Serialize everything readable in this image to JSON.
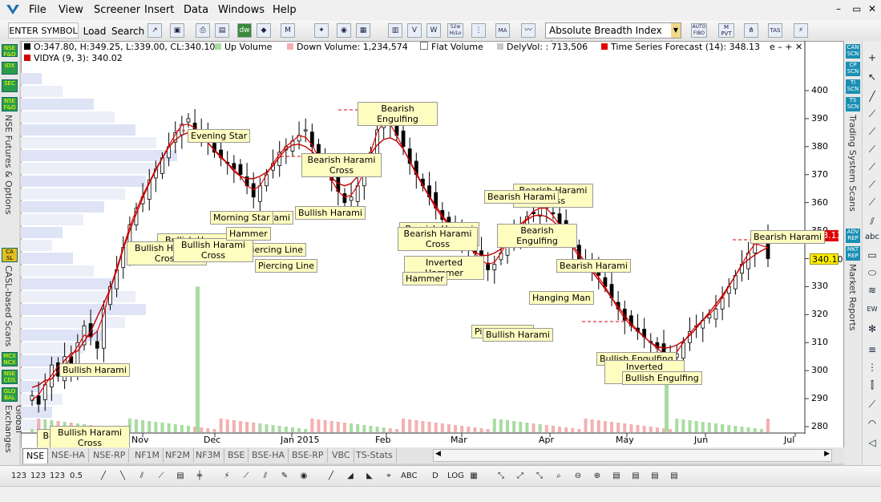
{
  "menu": {
    "items": [
      "File",
      "View",
      "Screener",
      "Insert",
      "Data",
      "Windows",
      "Help"
    ],
    "window_controls": [
      "–",
      "▭",
      "✕"
    ]
  },
  "toolbar": {
    "symbol_button": "ENTER SYMBOL",
    "load": "Load",
    "search": "Search",
    "indicator_value": "Absolute Breadth Index (ABI",
    "icon_labels": [
      "52w Hi/Lo",
      "MA",
      "AUTO FIBO",
      "M PVT",
      "TAS"
    ]
  },
  "legend": {
    "ohlc": "O:347.80, H:349.25, L:339.00, CL:340.10",
    "up_volume": "Up Volume",
    "down_volume": "Down Volume: 1,234,574",
    "flat_volume": "Flat Volume",
    "dely_vol": "DelyVol: : 713,506",
    "tsf": "Time Series Forecast (14): 348.13",
    "vidya": "VIDYA (9, 3): 340.02",
    "controls": "e – + ✕"
  },
  "colors": {
    "up_volume": "#a8dca0",
    "down_volume": "#f4b0b0",
    "flat_volume": "#ffffff",
    "dely_vol": "#c8c8c8",
    "tsf": "#e00000",
    "vidya": "#d00000",
    "price_tag_bg": "#e00000",
    "price_tag2_bg": "#ffee00"
  },
  "left_tabs": {
    "buttons": [
      "NSE F&O",
      "IDX",
      "SEC",
      "NSE F&O",
      "CA SL",
      "MCX NCX",
      "NSE CDS",
      "GLO BAL"
    ],
    "labels": [
      "NSE Futures & Options",
      "CASL-based Scans",
      "Global Exchanges"
    ]
  },
  "right_tabs": {
    "buttons": [
      "CAN SCN",
      "CP SCN",
      "TI SCN",
      "TS SCN",
      "ADV REP",
      "MKT REP"
    ],
    "labels": [
      "Trading System Scans",
      "Market Reports"
    ]
  },
  "price_tags": {
    "tsf": "348.13",
    "vidya": "340.10"
  },
  "exchange_tabs": [
    "NSE",
    "NSE-HA",
    "NSE-RP",
    "NF1M",
    "NF2M",
    "NF3M",
    "BSE",
    "BSE-HA",
    "BSE-RP",
    "VBC",
    "TS-Stats"
  ],
  "chart_data": {
    "type": "candlestick",
    "y_ticks": [
      400,
      390,
      380,
      370,
      360,
      350,
      340,
      330,
      320,
      310,
      300,
      290,
      280
    ],
    "ylim": [
      278,
      408
    ],
    "x_ticks": [
      "Oct 2014",
      "Nov",
      "Dec",
      "Jan 2015",
      "Feb",
      "Mar",
      "Apr",
      "May",
      "Jun",
      "Jul"
    ],
    "close_series": [
      291,
      288,
      295,
      302,
      298,
      305,
      300,
      310,
      316,
      312,
      308,
      322,
      330,
      336,
      344,
      352,
      358,
      362,
      368,
      372,
      376,
      380,
      385,
      388,
      390,
      386,
      384,
      382,
      378,
      376,
      374,
      372,
      370,
      366,
      362,
      366,
      370,
      374,
      378,
      380,
      382,
      384,
      386,
      380,
      376,
      372,
      368,
      364,
      360,
      362,
      366,
      370,
      378,
      386,
      392,
      388,
      384,
      380,
      374,
      370,
      366,
      362,
      358,
      354,
      352,
      350,
      346,
      344,
      342,
      340,
      336,
      338,
      342,
      346,
      350,
      352,
      355,
      356,
      360,
      358,
      356,
      352,
      348,
      344,
      340,
      338,
      336,
      334,
      330,
      326,
      322,
      318,
      316,
      314,
      312,
      310,
      308,
      306,
      304,
      306,
      310,
      314,
      316,
      318,
      320,
      322,
      326,
      330,
      334,
      338,
      342,
      346,
      348,
      340
    ],
    "patterns": [
      "Evening Star",
      "Bearish Engulfing",
      "Bearish Harami Cross",
      "Bullish Harami",
      "Bullish Harami Cross",
      "Bearish Harami Cross",
      "Bearish Harami",
      "Bearish Harami Cross",
      "Bearish Harami Cross",
      "Bullish Harami",
      "Piercing Line",
      "Piercing Line",
      "Bullish Harami Cross",
      "Bullish Harami",
      "Bullish Harami Cross",
      "Inverted Hammer",
      "Bearish Engulfing",
      "Bearish Harami",
      "Hanging Man",
      "Piercing Line",
      "Bullish Harami",
      "Bullish Engulfing",
      "Inverted Hammer",
      "Bullish Engulfing",
      "Hammer",
      "Bearish Harami Cross",
      "Bearish Harami",
      "Bullish Harami Cross",
      "Morning Star",
      "Hammer"
    ]
  }
}
